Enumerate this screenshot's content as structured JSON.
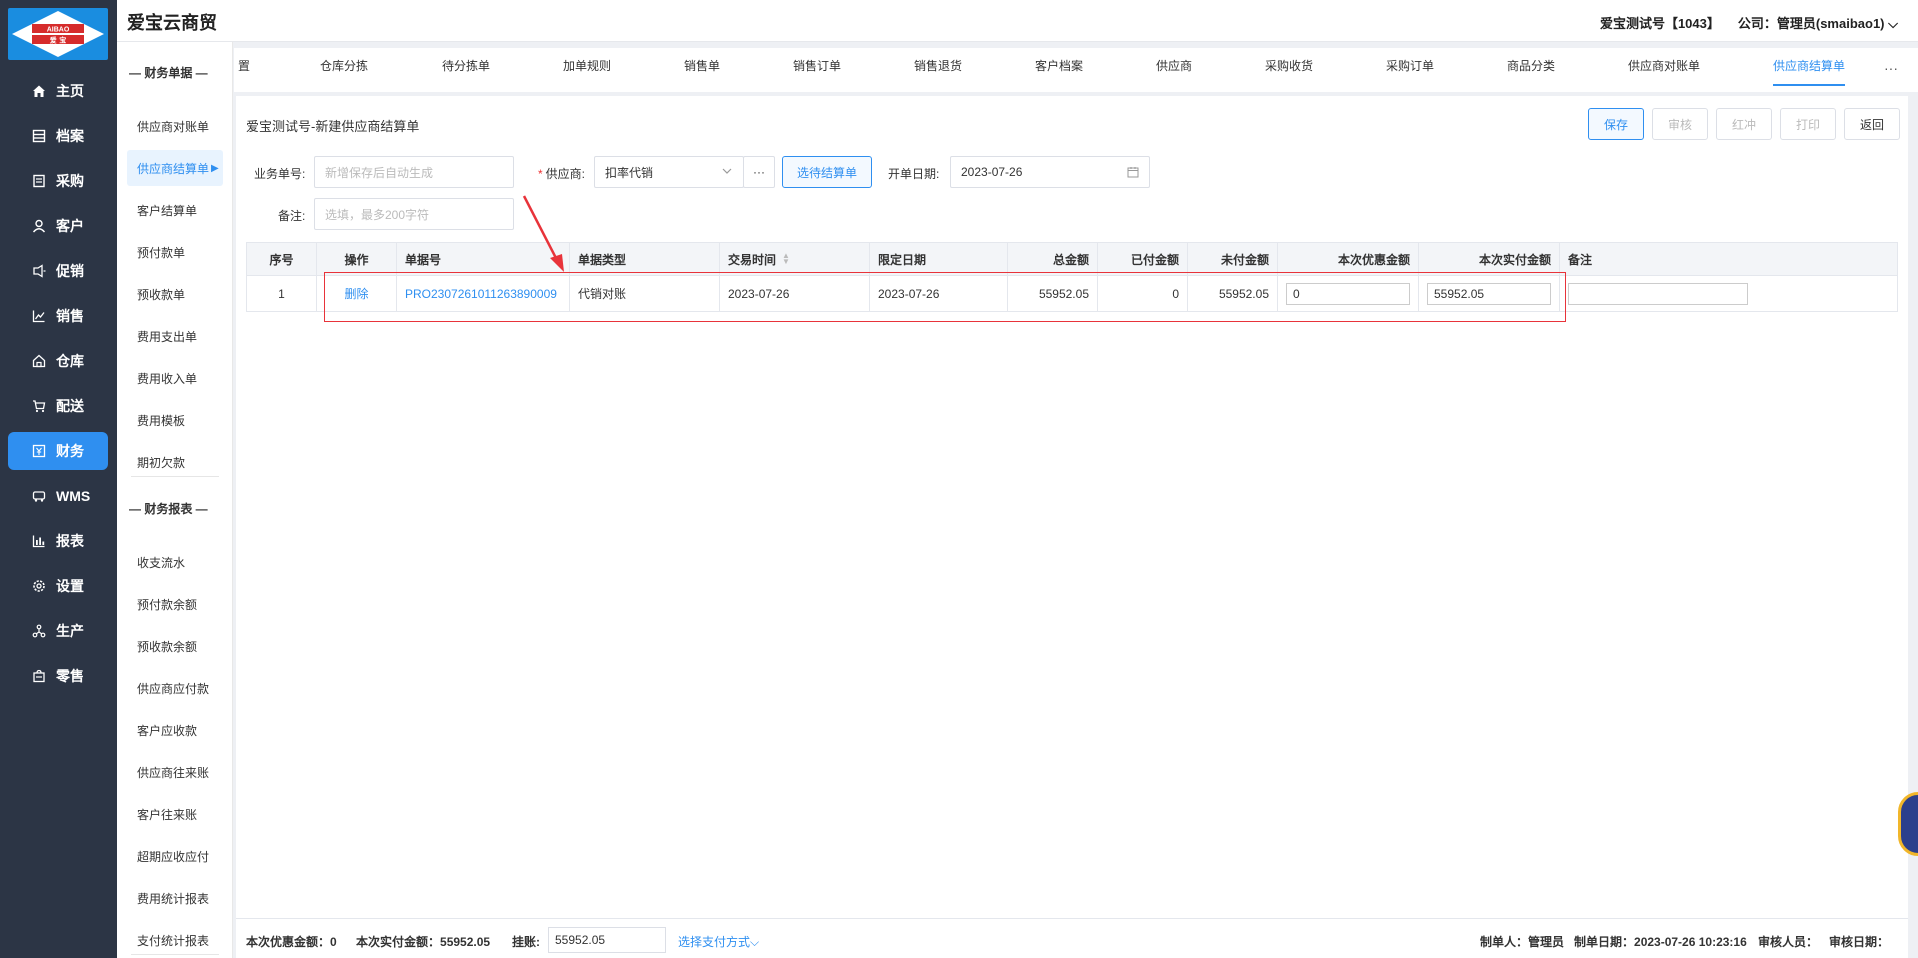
{
  "app": {
    "brand": "爱宝云商贸",
    "logo_text_top": "AIBAO",
    "logo_text_bottom": "爱 宝",
    "account": "爱宝测试号【1043】",
    "company": "公司：管理员(smaibao1)"
  },
  "colors": {
    "accent": "#2f8ff0",
    "sidebar": "#2c3545",
    "highlight": "#e8333a"
  },
  "nav": [
    {
      "label": "主页",
      "icon": "home-icon"
    },
    {
      "label": "档案",
      "icon": "archive-icon"
    },
    {
      "label": "采购",
      "icon": "cart-icon"
    },
    {
      "label": "客户",
      "icon": "user-icon"
    },
    {
      "label": "促销",
      "icon": "tag-icon"
    },
    {
      "label": "销售",
      "icon": "chart-icon"
    },
    {
      "label": "仓库",
      "icon": "warehouse-icon"
    },
    {
      "label": "配送",
      "icon": "delivery-icon"
    },
    {
      "label": "财务",
      "icon": "finance-icon"
    },
    {
      "label": "WMS",
      "icon": "truck-icon"
    },
    {
      "label": "报表",
      "icon": "report-icon"
    },
    {
      "label": "设置",
      "icon": "gear-icon"
    },
    {
      "label": "生产",
      "icon": "production-icon"
    },
    {
      "label": "零售",
      "icon": "bag-icon"
    }
  ],
  "subnav": {
    "group1": "— 财务单据 —",
    "items1": [
      "供应商对账单",
      "供应商结算单",
      "客户结算单",
      "预付款单",
      "预收款单",
      "费用支出单",
      "费用收入单",
      "费用模板",
      "期初欠款"
    ],
    "group2": "— 财务报表 —",
    "items2": [
      "收支流水",
      "预付款余额",
      "预收款余额",
      "供应商应付款",
      "客户应收款",
      "供应商往来账",
      "客户往来账",
      "超期应收应付",
      "费用统计报表",
      "支付统计报表"
    ]
  },
  "tabs": [
    "置",
    "仓库分拣",
    "待分拣单",
    "加单规则",
    "销售单",
    "销售订单",
    "销售退货",
    "客户档案",
    "供应商",
    "采购收货",
    "采购订单",
    "商品分类",
    "供应商对账单",
    "供应商结算单"
  ],
  "tab_more": "···",
  "form": {
    "title": "爱宝测试号-新建供应商结算单",
    "buttons": {
      "save": "保存",
      "audit": "审核",
      "red": "红冲",
      "print": "打印",
      "back": "返回"
    },
    "doc_no_label": "业务单号:",
    "doc_no_placeholder": "新增保存后自动生成",
    "supplier_label": "供应商:",
    "supplier_value": "扣率代销",
    "more_btn": "···",
    "select_btn": "选待结算单",
    "date_label": "开单日期:",
    "date_value": "2023-07-26",
    "remark_label": "备注:",
    "remark_placeholder": "选填，最多200字符"
  },
  "table": {
    "headers": [
      "序号",
      "操作",
      "单据号",
      "单据类型",
      "交易时间",
      "限定日期",
      "总金额",
      "已付金额",
      "未付金额",
      "本次优惠金额",
      "本次实付金额",
      "备注"
    ],
    "rows": [
      {
        "index": "1",
        "action": "删除",
        "doc_no": "PRO2307261011263890009",
        "doc_type": "代销对账",
        "trade_time": "2023-07-26",
        "limit_date": "2023-07-26",
        "total": "55952.05",
        "paid": "0",
        "unpaid": "55952.05",
        "discount": "0",
        "pay_now": "55952.05",
        "remark": ""
      }
    ]
  },
  "footer": {
    "discount_label": "本次优惠金额：",
    "discount_value": "0",
    "pay_label": "本次实付金额：",
    "pay_value": "55952.05",
    "account_label": "挂账:",
    "account_value": "55952.05",
    "pay_method": "选择支付方式",
    "maker_label": "制单人：",
    "maker_value": "管理员",
    "date_label": "制单日期：",
    "date_value": "2023-07-26 10:23:16",
    "auditor_label": "审核人员：",
    "audit_date_label": "审核日期："
  }
}
